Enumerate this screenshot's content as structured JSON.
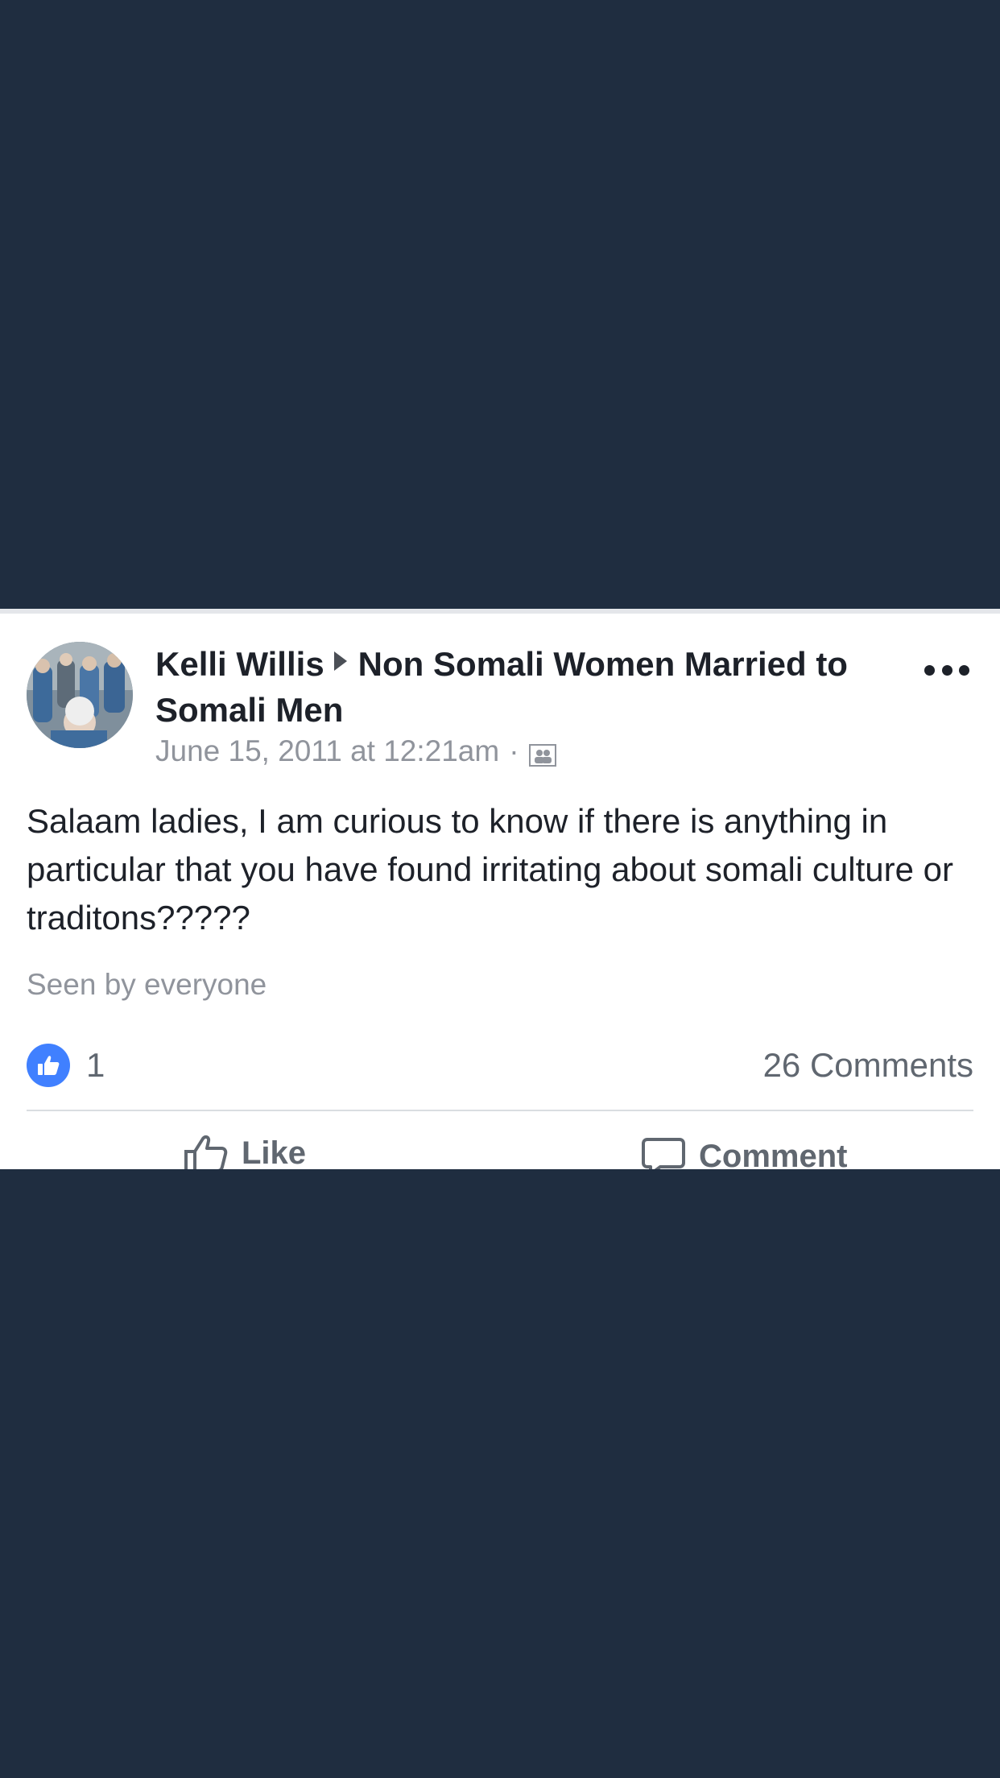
{
  "post": {
    "author": "Kelli Willis",
    "group": "Non Somali Women Married to Somali Men",
    "timestamp": "June 15, 2011 at 12:21am",
    "separator": "·",
    "audience_icon": "group-members-icon",
    "body": "Salaam ladies, I am curious to know if there is anything in particular that you have found irritating about somali culture or traditons?????",
    "seen_by": "Seen by everyone",
    "reaction_count": "1",
    "comment_count": "26 Comments"
  },
  "actions": {
    "like_label": "Like",
    "comment_label": "Comment"
  },
  "colors": {
    "background": "#1f2d40",
    "card": "#ffffff",
    "like_blue": "#4080ff",
    "secondary_text": "#90949c"
  }
}
